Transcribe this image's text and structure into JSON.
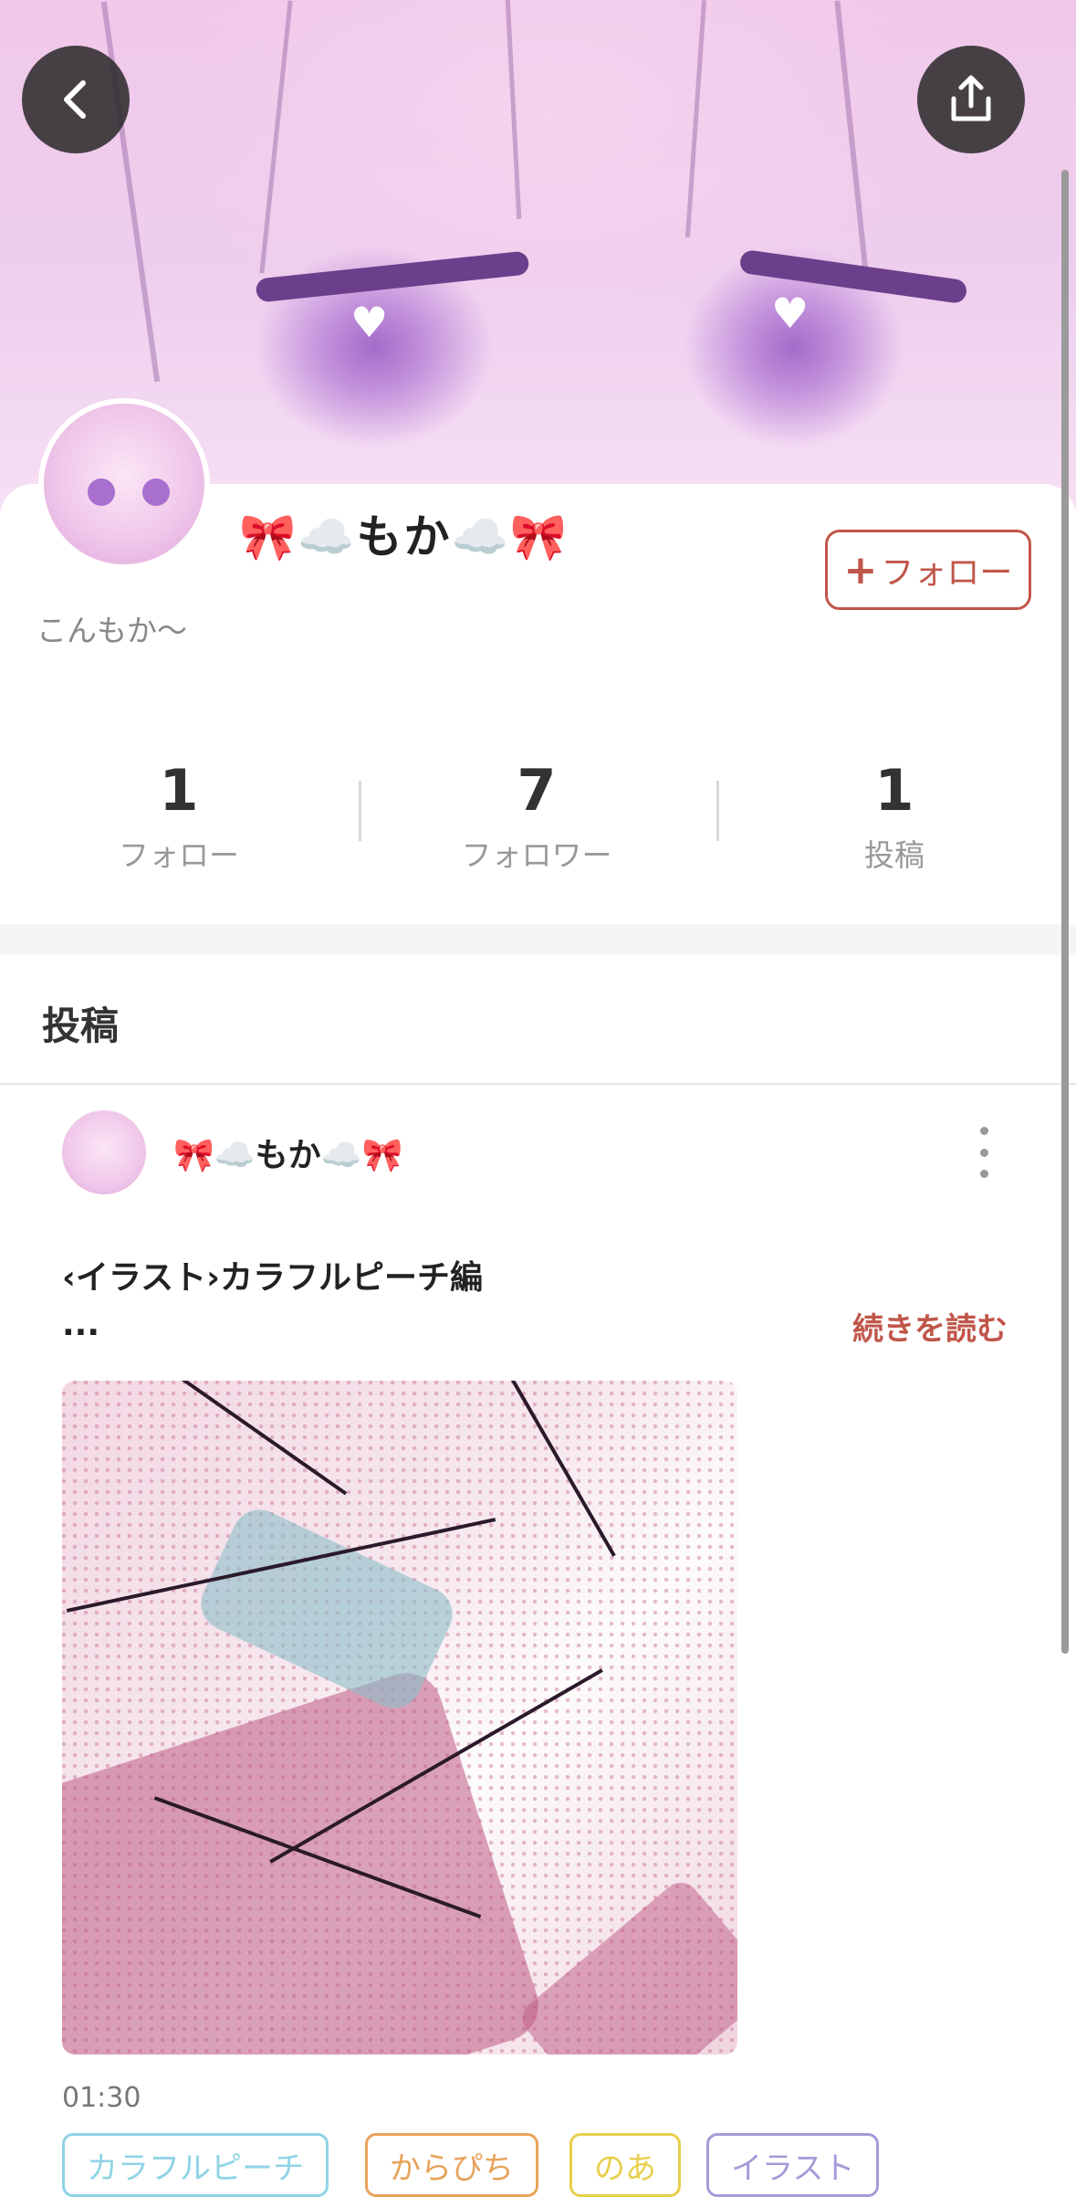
{
  "header": {
    "back_icon": "chevron-left-icon",
    "share_icon": "share-icon"
  },
  "profile": {
    "name": "🎀☁️もか☁️🎀",
    "bio": "こんもか〜",
    "follow_button": {
      "plus": "+",
      "label": "フォロー"
    },
    "stats": [
      {
        "value": "1",
        "label": "フォロー"
      },
      {
        "value": "7",
        "label": "フォロワー"
      },
      {
        "value": "1",
        "label": "投稿"
      }
    ]
  },
  "posts_section": {
    "title": "投稿",
    "post": {
      "author": "🎀☁️もか☁️🎀",
      "title": "‹イラスト›カラフルピーチ編",
      "ellipsis": "...",
      "read_more": "続きを読む",
      "timestamp": "01:30",
      "tags": [
        {
          "label": "カラフルピーチ",
          "color": "#8fd3e6"
        },
        {
          "label": "からぴち",
          "color": "#e8a25a"
        },
        {
          "label": "のあ",
          "color": "#e8cf4a"
        },
        {
          "label": "イラスト",
          "color": "#a79ad8"
        }
      ]
    }
  },
  "colors": {
    "accent": "#c0564a",
    "header_pink": "#f1c8ea"
  }
}
